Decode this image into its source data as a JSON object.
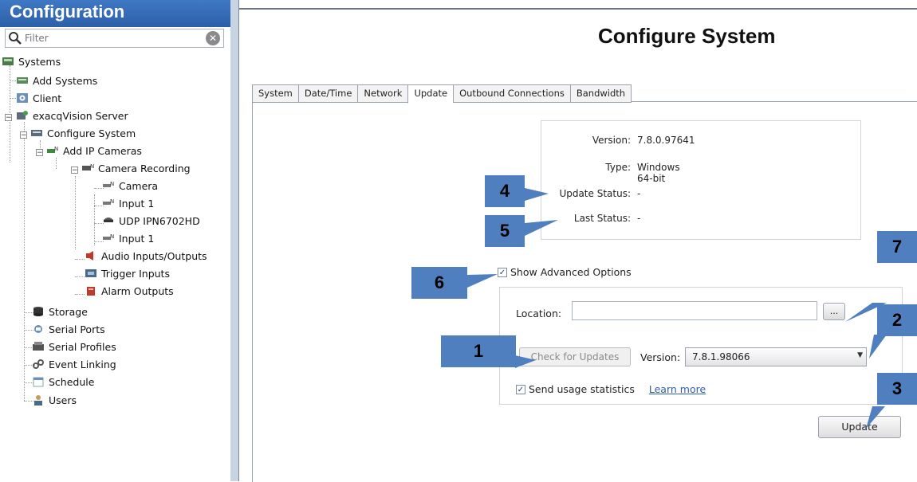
{
  "sidebar": {
    "header": "Configuration",
    "filter_placeholder": "Filter",
    "items": [
      {
        "label": "Systems"
      },
      {
        "label": "Add Systems"
      },
      {
        "label": "Client"
      },
      {
        "label": "exacqVision Server"
      },
      {
        "label": "Configure System"
      },
      {
        "label": "Add IP Cameras"
      },
      {
        "label": "Camera Recording"
      },
      {
        "label": "Camera"
      },
      {
        "label": "Input 1"
      },
      {
        "label": "UDP IPN6702HD"
      },
      {
        "label": "Input 1"
      },
      {
        "label": "Audio Inputs/Outputs"
      },
      {
        "label": "Trigger Inputs"
      },
      {
        "label": "Alarm Outputs"
      },
      {
        "label": "Storage"
      },
      {
        "label": "Serial Ports"
      },
      {
        "label": "Serial Profiles"
      },
      {
        "label": "Event Linking"
      },
      {
        "label": "Schedule"
      },
      {
        "label": "Users"
      }
    ]
  },
  "main": {
    "title": "Configure System",
    "tabs": [
      "System",
      "Date/Time",
      "Network",
      "Update",
      "Outbound Connections",
      "Bandwidth"
    ],
    "active_tab": "Update",
    "info": {
      "version_label": "Version:",
      "version_value": "7.8.0.97641",
      "type_label": "Type:",
      "type_value": "Windows 64-bit",
      "update_status_label": "Update Status:",
      "update_status_value": "-",
      "last_status_label": "Last Status:",
      "last_status_value": "-"
    },
    "advanced": {
      "show_label": "Show Advanced Options",
      "checked": true,
      "location_label": "Location:",
      "location_value": "",
      "browse_label": "...",
      "check_button": "Check for Updates",
      "version_label": "Version:",
      "version_selected": "7.8.1.98066",
      "usage_label": "Send usage statistics",
      "usage_checked": true,
      "learn_more": "Learn more"
    },
    "update_button": "Update"
  },
  "callouts": [
    "1",
    "2",
    "3",
    "4",
    "5",
    "6",
    "7"
  ],
  "colors": {
    "callout": "#4f7fbf",
    "header": "#2d5fa8",
    "link": "#2f5ea8"
  }
}
